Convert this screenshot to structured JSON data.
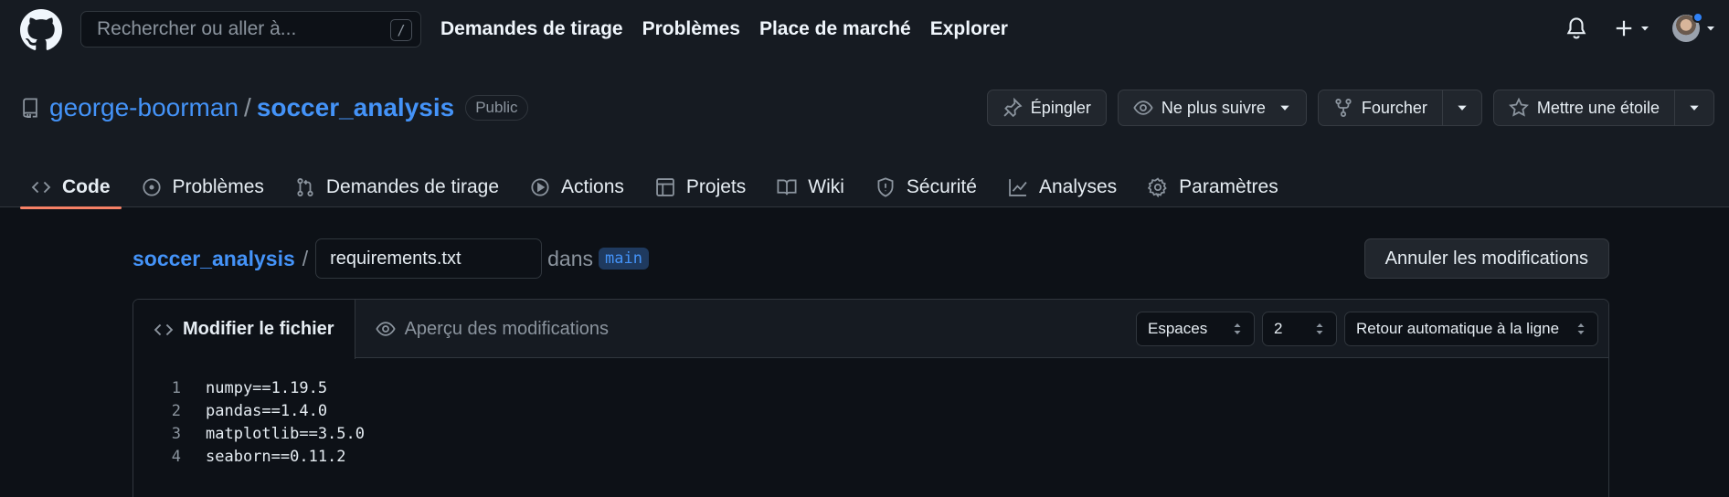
{
  "header": {
    "search_placeholder": "Rechercher ou aller à...",
    "search_shortcut": "/",
    "nav": [
      "Demandes de tirage",
      "Problèmes",
      "Place de marché",
      "Explorer"
    ]
  },
  "repo": {
    "owner": "george-boorman",
    "separator": "/",
    "name": "soccer_analysis",
    "visibility": "Public",
    "actions": {
      "pin": "Épingler",
      "unwatch": "Ne plus suivre",
      "fork": "Fourcher",
      "star": "Mettre une étoile"
    },
    "tabs": [
      "Code",
      "Problèmes",
      "Demandes de tirage",
      "Actions",
      "Projets",
      "Wiki",
      "Sécurité",
      "Analyses",
      "Paramètres"
    ]
  },
  "editor": {
    "path_repo": "soccer_analysis",
    "path_sep": "/",
    "filename": "requirements.txt",
    "in_label": "dans",
    "branch": "main",
    "cancel_label": "Annuler les modifications",
    "tab_edit": "Modifier le fichier",
    "tab_preview": "Aperçu des modifications",
    "indent_mode": "Espaces",
    "indent_size": "2",
    "wrap_mode": "Retour automatique à la ligne",
    "lines": [
      {
        "n": "1",
        "text": "numpy==1.19.5"
      },
      {
        "n": "2",
        "text": "pandas==1.4.0"
      },
      {
        "n": "3",
        "text": "matplotlib==3.5.0"
      },
      {
        "n": "4",
        "text": "seaborn==0.11.2"
      }
    ]
  },
  "colors": {
    "accent_link": "#4493f8",
    "active_tab_underline": "#f78166",
    "background": "#0d1117",
    "header_bg": "#161b22"
  }
}
